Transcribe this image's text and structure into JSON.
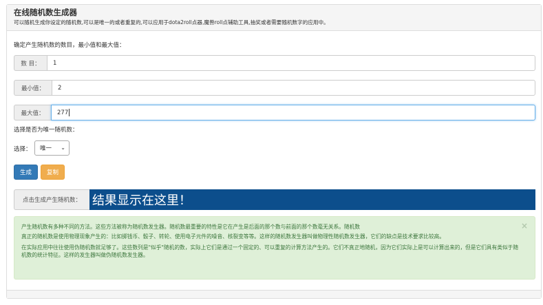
{
  "header": {
    "title": "在线随机数生成器",
    "subtitle": "可以随机生成你设定的随机数,可以是唯一的或者重复的,可以应用于dota2roll点器,魔兽roll点辅助工具,抽奖或者需要随机数字的应用中。"
  },
  "form": {
    "instruction": "确定产生随机数的数目，最小值和最大值：",
    "count_label": "数 目：",
    "count_value": "1",
    "min_label": "最小值：",
    "min_value": "2",
    "max_label": "最大值：",
    "max_value": "277",
    "unique_question": "选择是否为唯一随机数：",
    "select_label": "选择：",
    "select_value": "唯一"
  },
  "buttons": {
    "generate_label": "生成",
    "copy_label": "复制"
  },
  "result": {
    "label": "点击生成产生随机数：",
    "value": "结果显示在这里！"
  },
  "alert": {
    "paragraph1": "产生随机数有多种不同的方法。这些方法被称为随机数发生器。随机数最重要的特性是它在产生是后面的那个数与前面的那个数毫无关系。随机数",
    "paragraph2": "真正的随机数是使用物理现象产生的：比如掷钱币、骰子、转轮、使用电子元件的噪音、核裂变等等。这样的随机数发生器叫做物理性随机数发生器，它们的缺点是技术要求比较高。",
    "paragraph3": "在实际应用中往往使用伪随机数就足够了。这些数列是\"似乎\"随机的数，实际上它们是通过一个固定的、可以重复的计算方法产生的。它们不真正地随机，因为它们实际上是可以计算出来的，但是它们具有类似于随机数的统计特征。这样的发生器叫做伪随机数发生器。",
    "close_symbol": "×"
  },
  "colors": {
    "primary": "#337ab7",
    "warning": "#f0ad4e",
    "result_bg": "#0c4e8c",
    "alert_bg": "#dff0d8",
    "alert_text": "#3c763d"
  }
}
